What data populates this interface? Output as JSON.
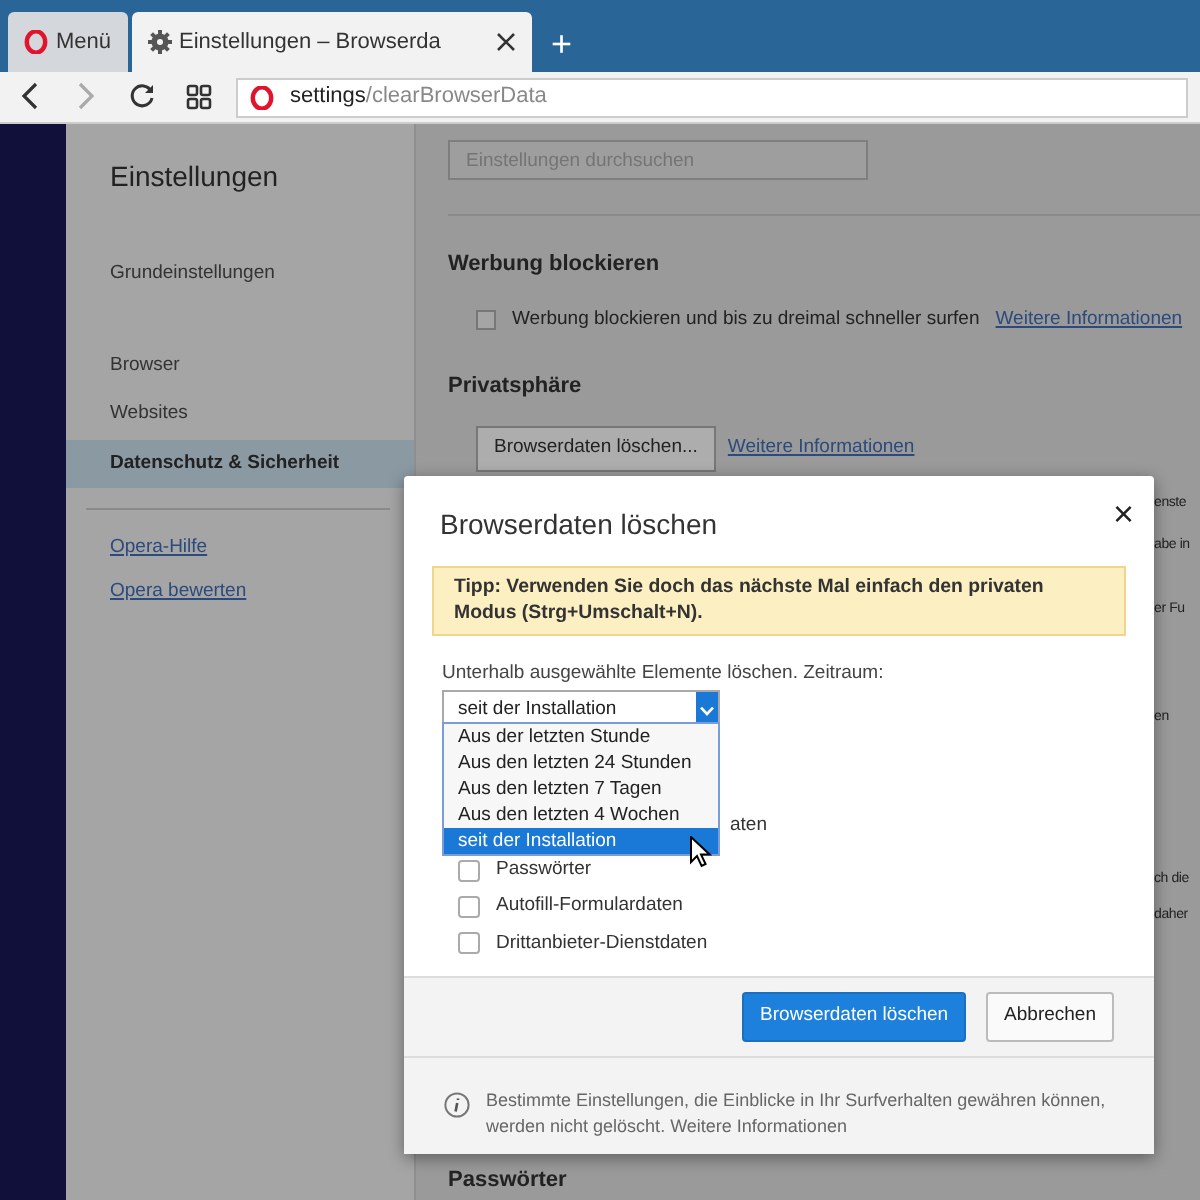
{
  "browser": {
    "tabs": [
      {
        "kind": "menu",
        "label": "Menü",
        "selected": false
      },
      {
        "kind": "page",
        "label": "Einstellungen – Browserda",
        "selected": true
      }
    ],
    "new_tab": "+",
    "address": {
      "host": "settings",
      "path": "/clearBrowserData"
    }
  },
  "sidebar": {
    "title": "Einstellungen",
    "groups": [
      [
        {
          "label": "Grundeinstellungen",
          "selected": false
        }
      ],
      [
        {
          "label": "Browser",
          "selected": false
        },
        {
          "label": "Websites",
          "selected": false
        },
        {
          "label": "Datenschutz & Sicherheit",
          "selected": true
        }
      ]
    ],
    "links": [
      "Opera-Hilfe",
      "Opera bewerten"
    ]
  },
  "main": {
    "search": {
      "placeholder": "Einstellungen durchsuchen"
    },
    "adblock": {
      "heading": "Werbung blockieren",
      "checkbox": {
        "label": "Werbung blockieren und bis zu dreimal schneller surfen",
        "checked": false
      },
      "link": "Weitere Informationen"
    },
    "privacy": {
      "heading": "Privatsphäre",
      "button": "Browserdaten löschen...",
      "link": "Weitere Informationen"
    },
    "fragments": [
      "enste",
      "abe in",
      "er Fu",
      "en",
      "ch die",
      "daher"
    ],
    "bottom_heading": "Passwörter"
  },
  "dialog": {
    "title": "Browserdaten löschen",
    "close": "×",
    "tip": "Tipp: Verwenden Sie doch das nächste Mal einfach den privaten Modus (Strg+Umschalt+N).",
    "range_label": "Unterhalb ausgewählte Elemente löschen. Zeitraum:",
    "range_value": "seit der Installation",
    "options": [
      {
        "label": "Aus der letzten Stunde",
        "selected": false
      },
      {
        "label": "Aus den letzten 24 Stunden",
        "selected": false
      },
      {
        "label": "Aus den letzten 7 Tagen",
        "selected": false
      },
      {
        "label": "Aus den letzten 4 Wochen",
        "selected": false
      },
      {
        "label": "seit der Installation",
        "selected": true
      }
    ],
    "hidden_fragment": "aten",
    "items": [
      {
        "label": "Passwörter",
        "checked": false
      },
      {
        "label": "Autofill-Formulardaten",
        "checked": false
      },
      {
        "label": "Drittanbieter-Dienstdaten",
        "checked": false
      }
    ],
    "buttons": [
      {
        "kind": "primary",
        "label": "Browserdaten löschen"
      },
      {
        "kind": "secondary",
        "label": "Abbrechen"
      }
    ],
    "info": {
      "text": "Bestimmte Einstellungen, die Einblicke in Ihr Surfverhalten gewähren können,",
      "link1": "werden nicht gelöscht",
      "sep": ".",
      "link2": "Weitere Informationen"
    }
  }
}
